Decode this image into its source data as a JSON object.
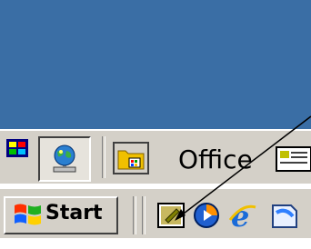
{
  "office_toolbar": {
    "office_label": "Office"
  },
  "taskbar": {
    "start_label": "Start",
    "quick_launch": [
      {
        "icon": "show-desktop-icon"
      },
      {
        "icon": "media-player-icon"
      },
      {
        "icon": "internet-explorer-icon"
      },
      {
        "icon": "outlook-express-icon"
      }
    ]
  },
  "colors": {
    "desktop": "#3a6ea5",
    "taskbar": "#d4d0c8",
    "annotation_arrow": "#000000"
  }
}
